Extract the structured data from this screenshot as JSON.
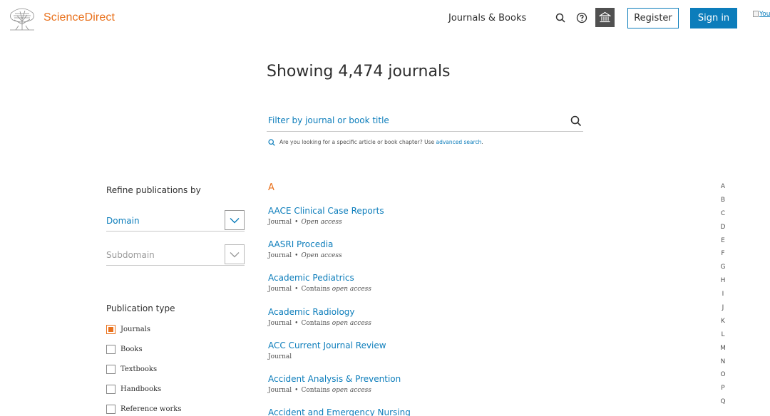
{
  "header": {
    "brand": "ScienceDirect",
    "nav_link": "Journals & Books",
    "register_label": "Register",
    "signin_label": "Sign in",
    "broken_image_alt": "Your"
  },
  "main": {
    "title": "Showing 4,474 journals",
    "filter_placeholder": "Filter by journal or book title",
    "hint_text": "Are you looking for a specific article or book chapter? Use ",
    "hint_link": "advanced search",
    "hint_end": "."
  },
  "sidebar": {
    "refine_label": "Refine publications by",
    "domain_label": "Domain",
    "subdomain_label": "Subdomain",
    "pubtype_label": "Publication type",
    "pub_types": [
      {
        "label": "Journals",
        "checked": true
      },
      {
        "label": "Books",
        "checked": false
      },
      {
        "label": "Textbooks",
        "checked": false
      },
      {
        "label": "Handbooks",
        "checked": false
      },
      {
        "label": "Reference works",
        "checked": false
      }
    ]
  },
  "journals": {
    "letter": "A",
    "items": [
      {
        "title": "AACE Clinical Case Reports",
        "type": "Journal",
        "access_prefix": "",
        "access": "Open access"
      },
      {
        "title": "AASRI Procedia",
        "type": "Journal",
        "access_prefix": "",
        "access": "Open access"
      },
      {
        "title": "Academic Pediatrics",
        "type": "Journal",
        "access_prefix": "Contains ",
        "access": "open access"
      },
      {
        "title": "Academic Radiology",
        "type": "Journal",
        "access_prefix": "Contains ",
        "access": "open access"
      },
      {
        "title": "ACC Current Journal Review",
        "type": "Journal",
        "access_prefix": "",
        "access": ""
      },
      {
        "title": "Accident Analysis & Prevention",
        "type": "Journal",
        "access_prefix": "Contains ",
        "access": "open access"
      },
      {
        "title": "Accident and Emergency Nursing",
        "type": "",
        "access_prefix": "",
        "access": ""
      }
    ]
  },
  "alphabet": [
    "A",
    "B",
    "C",
    "D",
    "E",
    "F",
    "G",
    "H",
    "I",
    "J",
    "K",
    "L",
    "M",
    "N",
    "O",
    "P",
    "Q"
  ],
  "colors": {
    "brand_orange": "#e9711c",
    "link_blue": "#0c7dbb",
    "dark_gray": "#505050"
  }
}
